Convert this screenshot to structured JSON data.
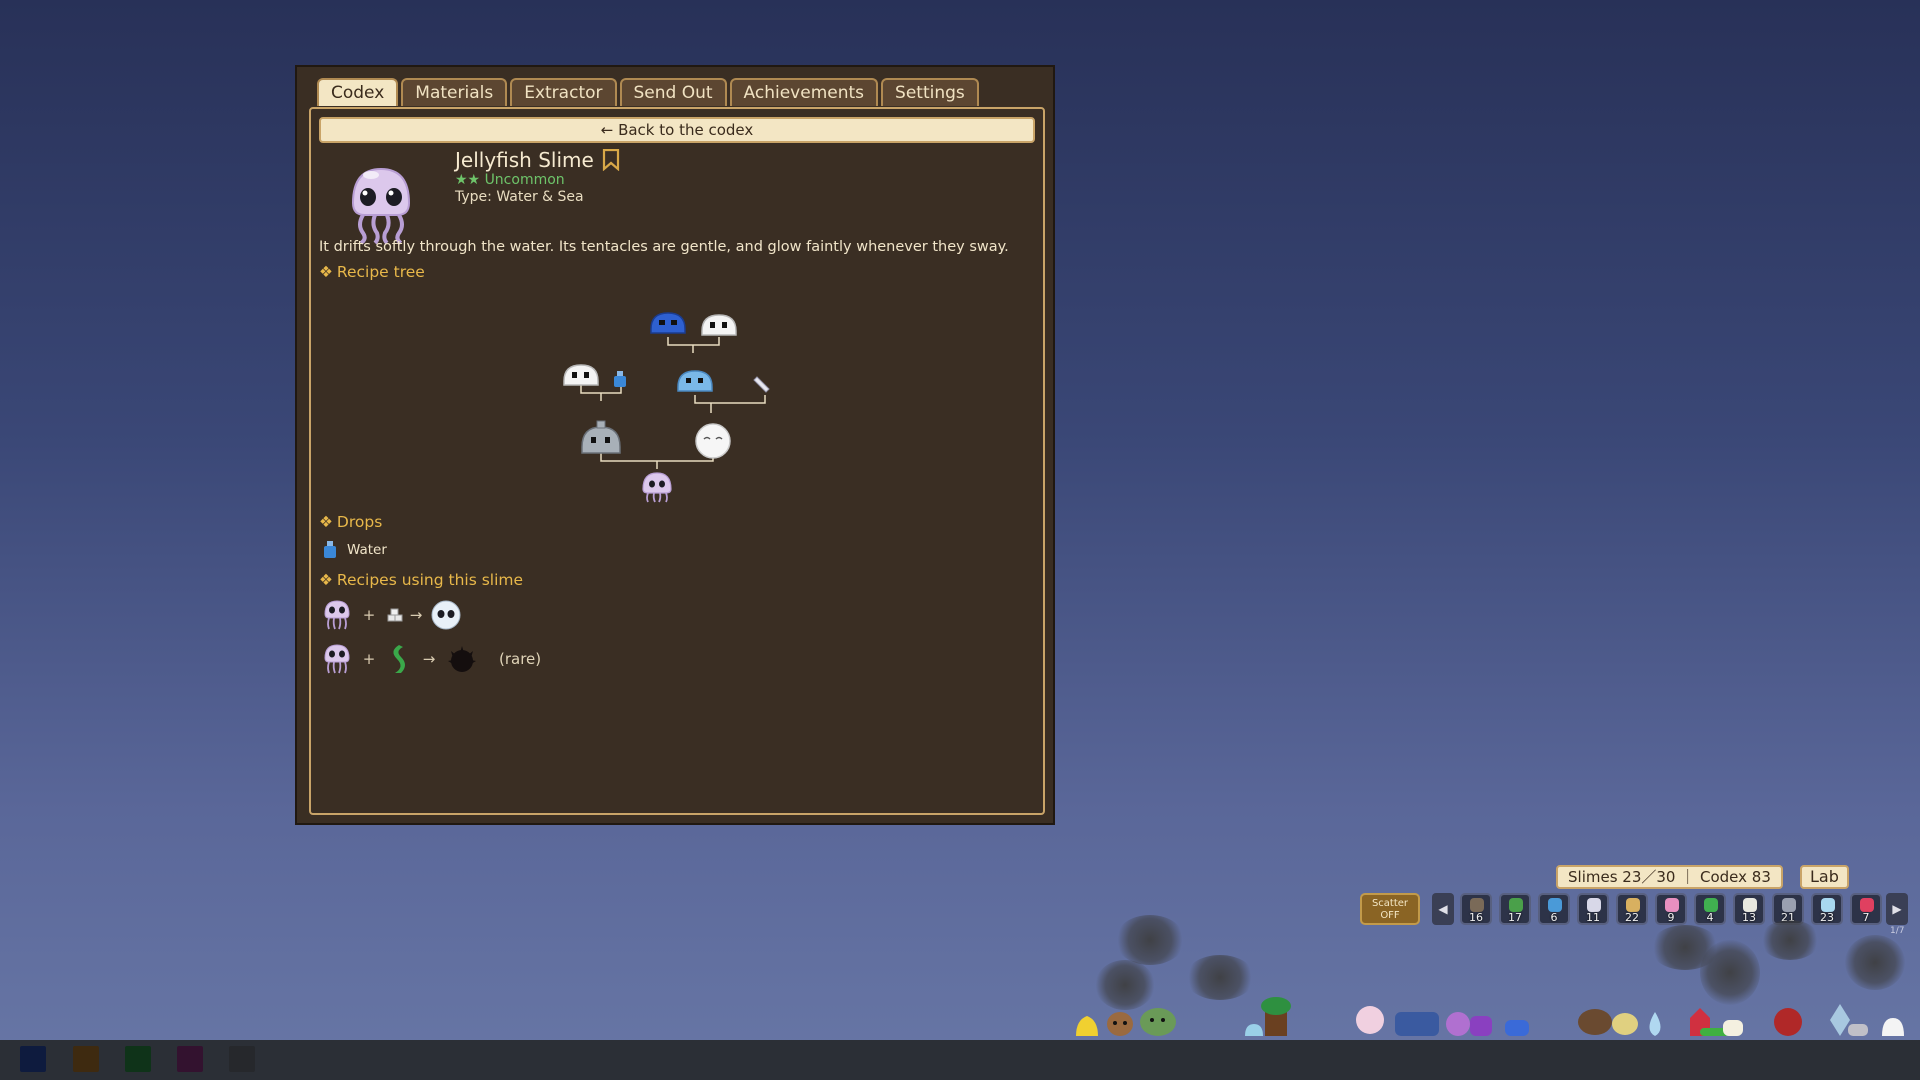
{
  "tabs": [
    "Codex",
    "Materials",
    "Extractor",
    "Send Out",
    "Achievements",
    "Settings"
  ],
  "active_tab": "Codex",
  "back_label": "← Back to the codex",
  "slime": {
    "name": "Jellyfish Slime",
    "rarity_stars": "★★",
    "rarity": "Uncommon",
    "type": "Type: Water & Sea",
    "description": "It drifts softly through the water. Its tentacles are gentle, and glow faintly whenever they sway."
  },
  "sections": {
    "recipe_tree": "Recipe tree",
    "drops": "Drops",
    "recipes_using": "Recipes using this slime"
  },
  "drops": [
    {
      "name": "Water",
      "icon": "water-bottle-icon"
    }
  ],
  "recipes_using": [
    {
      "a": "jellyfish-slime",
      "b": "sugar-cubes",
      "result": "snow-slime",
      "note": ""
    },
    {
      "a": "jellyfish-slime",
      "b": "seaweed",
      "result": "urchin-slime",
      "note": "(rare)"
    }
  ],
  "recipe_ops": {
    "plus": "+",
    "arrow": "→"
  },
  "hud": {
    "counter": "Slimes 23／30 ｜ Codex 83",
    "lab": "Lab",
    "scatter_line1": "Scatter",
    "scatter_line2": "OFF",
    "prev": "◀",
    "next": "▶",
    "page": "1/7"
  },
  "inventory": [
    {
      "icon": "rock-icon",
      "count": "16",
      "color": "#7a6a58"
    },
    {
      "icon": "leaf-icon",
      "count": "17",
      "color": "#4aa04a"
    },
    {
      "icon": "water-bottle-icon",
      "count": "6",
      "color": "#4a9ad8"
    },
    {
      "icon": "feather-icon",
      "count": "11",
      "color": "#d8d8e8"
    },
    {
      "icon": "bread-icon",
      "count": "22",
      "color": "#d8b060"
    },
    {
      "icon": "flower-icon",
      "count": "9",
      "color": "#e890c0"
    },
    {
      "icon": "clover-icon",
      "count": "4",
      "color": "#40b050"
    },
    {
      "icon": "bone-icon",
      "count": "13",
      "color": "#e8e8e0"
    },
    {
      "icon": "anvil-icon",
      "count": "21",
      "color": "#9aa0b0"
    },
    {
      "icon": "potion-icon",
      "count": "23",
      "color": "#a8d8f0"
    },
    {
      "icon": "gem-icon",
      "count": "7",
      "color": "#e04060"
    }
  ],
  "swatches": [
    "#0e1b3e",
    "#3e2a10",
    "#0f3319",
    "#33122f",
    "#26282c"
  ]
}
